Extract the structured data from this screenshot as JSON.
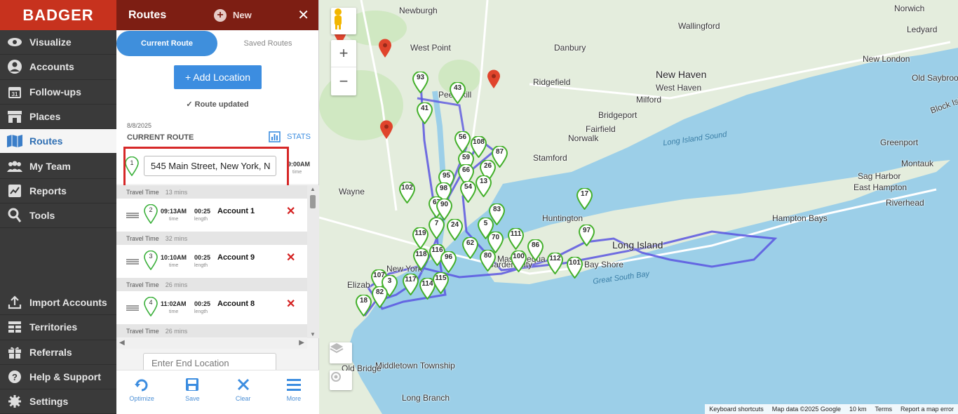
{
  "app": {
    "logo": "BADGER",
    "brand_color": "#c7321e"
  },
  "nav": {
    "items": [
      {
        "label": "Visualize",
        "icon": "eye-icon"
      },
      {
        "label": "Accounts",
        "icon": "person-icon"
      },
      {
        "label": "Follow-ups",
        "icon": "calendar-icon"
      },
      {
        "label": "Places",
        "icon": "store-icon"
      },
      {
        "label": "Routes",
        "icon": "map-icon",
        "active": true
      },
      {
        "label": "My Team",
        "icon": "team-icon"
      },
      {
        "label": "Reports",
        "icon": "chart-icon"
      },
      {
        "label": "Tools",
        "icon": "tools-icon"
      }
    ],
    "bottom_items": [
      {
        "label": "Import Accounts",
        "icon": "upload-icon"
      },
      {
        "label": "Territories",
        "icon": "grid-icon"
      },
      {
        "label": "Referrals",
        "icon": "gift-icon"
      },
      {
        "label": "Help & Support",
        "icon": "help-icon"
      },
      {
        "label": "Settings",
        "icon": "gear-icon"
      }
    ]
  },
  "panel": {
    "title": "Routes",
    "new_label": "New",
    "close_glyph": "✕",
    "tabs": [
      "Current Route",
      "Saved Routes"
    ],
    "add_location_label": "+ Add Location",
    "updated_text": "Route updated",
    "route_date": "8/8/2025",
    "route_label": "CURRENT ROUTE",
    "stats_label": "STATS",
    "start": {
      "number": "1",
      "address": "545 Main Street, New York, N",
      "time": "9:00AM",
      "time_label": "time"
    },
    "travel_times": [
      {
        "label": "Travel Time",
        "value": "13 mins"
      },
      {
        "label": "Travel Time",
        "value": "32 mins"
      },
      {
        "label": "Travel Time",
        "value": "26 mins"
      },
      {
        "label": "Travel Time",
        "value": "26 mins"
      }
    ],
    "stops": [
      {
        "number": "2",
        "time": "09:13AM",
        "time_label": "time",
        "duration": "00:25",
        "duration_label": "length",
        "account": "Account 1"
      },
      {
        "number": "3",
        "time": "10:10AM",
        "time_label": "time",
        "duration": "00:25",
        "duration_label": "length",
        "account": "Account 9"
      },
      {
        "number": "4",
        "time": "11:02AM",
        "time_label": "time",
        "duration": "00:25",
        "duration_label": "length",
        "account": "Account 8"
      }
    ],
    "end_placeholder": "Enter End Location",
    "bottom_actions": [
      {
        "label": "Optimize",
        "icon": "optimize-icon"
      },
      {
        "label": "Save",
        "icon": "save-icon"
      },
      {
        "label": "Clear",
        "icon": "clear-icon"
      },
      {
        "label": "More",
        "icon": "menu-icon"
      }
    ]
  },
  "map": {
    "places": [
      "Newburgh",
      "West Point",
      "Danbury",
      "Wallingford",
      "Norwich",
      "Ledyard",
      "New Haven",
      "West Haven",
      "New London",
      "Old Saybrook",
      "Ridgefield",
      "Milford",
      "Bridgeport",
      "Fairfield",
      "Norwalk",
      "Stamford",
      "Greenport",
      "Block Island",
      "Montauk",
      "Sag Harbor",
      "East Hampton",
      "Riverhead",
      "Wayne",
      "Huntington",
      "Hampton Bays",
      "Long Island",
      "Bay Shore",
      "Massapequa",
      "Middletown Township",
      "Long Branch",
      "Old Bridge",
      "Elizab",
      "Peekskill",
      "New York",
      "Garden City"
    ],
    "water_labels": [
      "Long Island Sound",
      "Great South Bay"
    ],
    "markers": [
      "93",
      "43",
      "41",
      "56",
      "108",
      "87",
      "59",
      "26",
      "66",
      "95",
      "98",
      "54",
      "13",
      "102",
      "67",
      "90",
      "83",
      "24",
      "7",
      "119",
      "62",
      "70",
      "111",
      "86",
      "97",
      "17",
      "116",
      "118",
      "96",
      "80",
      "100",
      "112",
      "101",
      "107",
      "3",
      "117",
      "114",
      "115",
      "82",
      "18",
      "5"
    ],
    "red_marker_count": 4,
    "zoom_in": "+",
    "zoom_out": "−",
    "attribution": [
      "Keyboard shortcuts",
      "Map data ©2025 Google",
      "10 km",
      "Terms",
      "Report a map error"
    ]
  }
}
